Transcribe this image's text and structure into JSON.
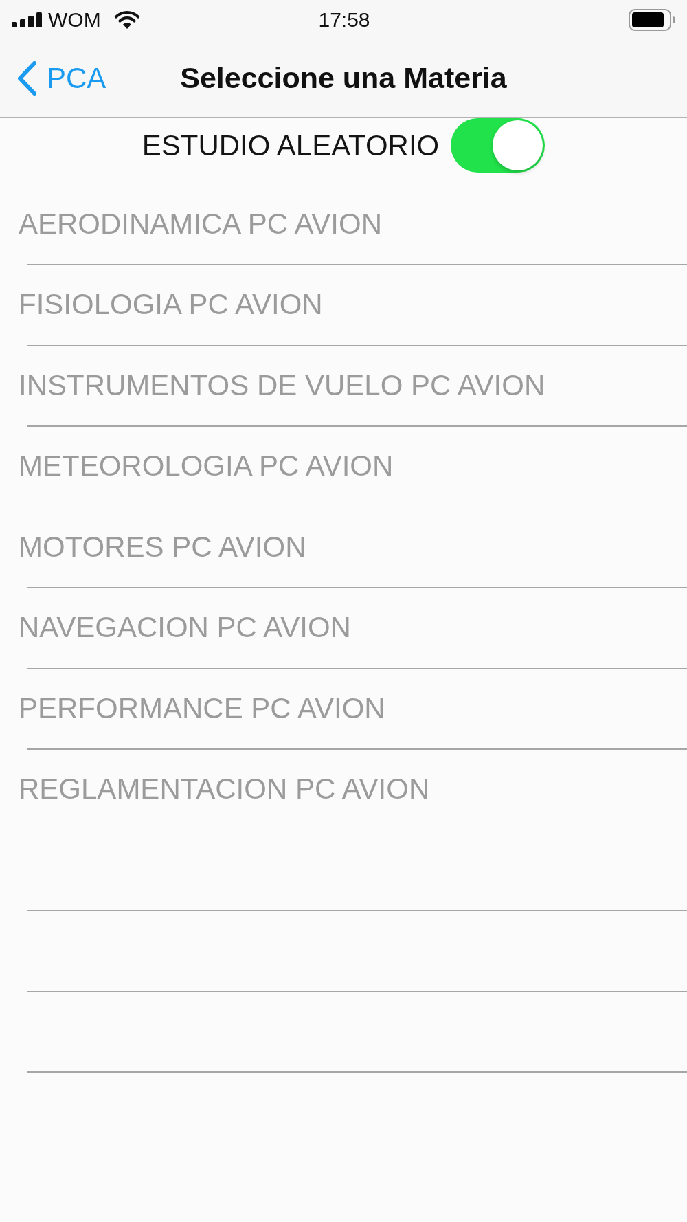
{
  "status_bar": {
    "carrier": "WOM",
    "time": "17:58"
  },
  "nav_bar": {
    "back_label": "PCA",
    "title": "Seleccione una Materia"
  },
  "random_study": {
    "label": "ESTUDIO ALEATORIO",
    "on": true
  },
  "subjects": [
    {
      "label": "AERODINAMICA PC AVION"
    },
    {
      "label": "FISIOLOGIA PC AVION"
    },
    {
      "label": "INSTRUMENTOS DE VUELO PC AVION"
    },
    {
      "label": "METEOROLOGIA PC AVION"
    },
    {
      "label": "MOTORES PC AVION"
    },
    {
      "label": "NAVEGACION PC AVION"
    },
    {
      "label": "PERFORMANCE PC AVION"
    },
    {
      "label": "REGLAMENTACION PC AVION"
    }
  ]
}
